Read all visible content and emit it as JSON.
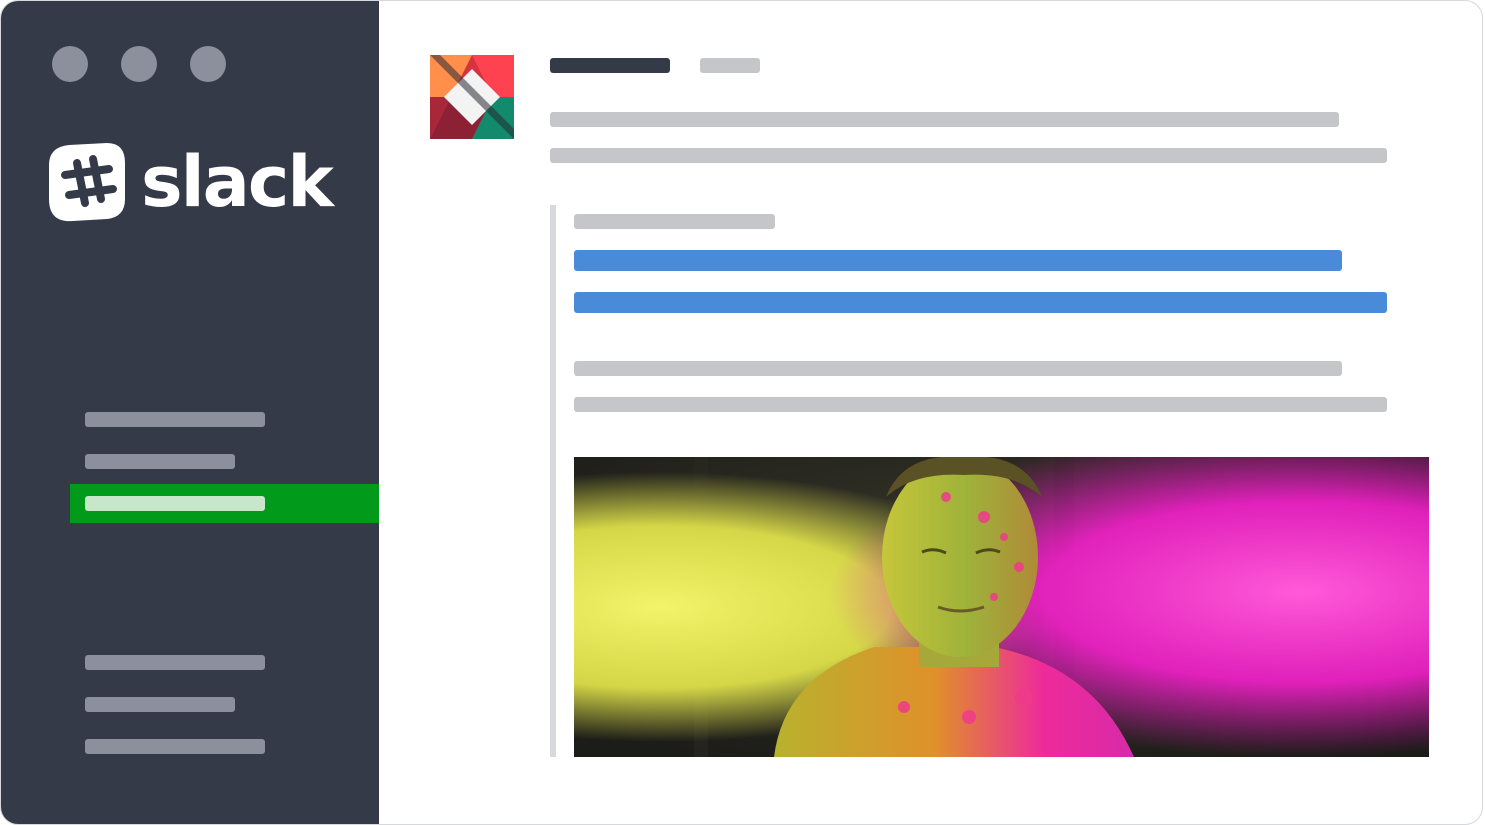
{
  "app": {
    "logo_text": "slack",
    "logo_icon": "slack-hash-icon"
  },
  "colors": {
    "sidebar_bg": "#343a48",
    "active_item_bg": "#019a1a",
    "link_blue": "#4a8bd9",
    "placeholder_gray": "#c5c6ca"
  },
  "sidebar": {
    "window_controls": [
      "close-dot",
      "minimize-dot",
      "maximize-dot"
    ],
    "channel_items": [
      "placeholder",
      "placeholder",
      "placeholder-active"
    ],
    "direct_message_items": [
      "placeholder",
      "placeholder",
      "placeholder"
    ],
    "active_index": 2
  },
  "message": {
    "avatar_icon": "team-avatar-icon",
    "attachment": {
      "image_description_icon": "color-powder-photo"
    }
  }
}
